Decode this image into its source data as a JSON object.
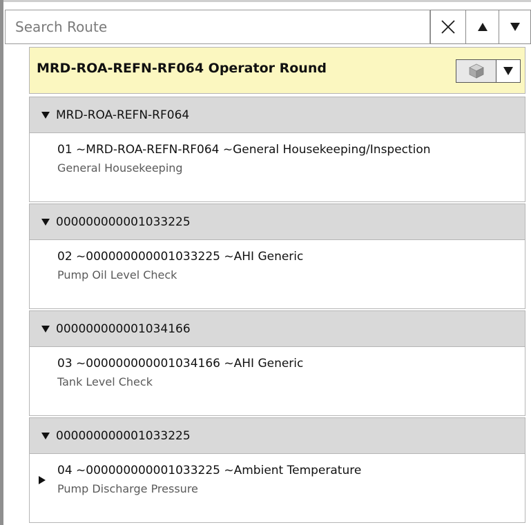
{
  "search": {
    "placeholder": "Search Route",
    "clear_icon": "close-icon",
    "prev_icon": "triangle-up-icon",
    "next_icon": "triangle-down-icon"
  },
  "route": {
    "title": "MRD-ROA-REFN-RF064 Operator Round",
    "header_bg": "#fbf7c0",
    "menu_icon": "cube-icon",
    "dropdown_icon": "triangle-down-icon"
  },
  "groups": [
    {
      "label": "MRD-ROA-REFN-RF064",
      "step_title": "01 ~MRD-ROA-REFN-RF064 ~General Housekeeping/Inspection",
      "step_subtitle": "General Housekeeping",
      "current": false
    },
    {
      "label": "000000000001033225",
      "step_title": "02 ~000000000001033225 ~AHI Generic",
      "step_subtitle": "Pump Oil Level Check",
      "current": false
    },
    {
      "label": "000000000001034166",
      "step_title": "03 ~000000000001034166 ~AHI Generic",
      "step_subtitle": "Tank Level Check",
      "current": false
    },
    {
      "label": "000000000001033225",
      "step_title": "04 ~000000000001033225 ~Ambient Temperature",
      "step_subtitle": "Pump Discharge Pressure",
      "current": true
    }
  ]
}
